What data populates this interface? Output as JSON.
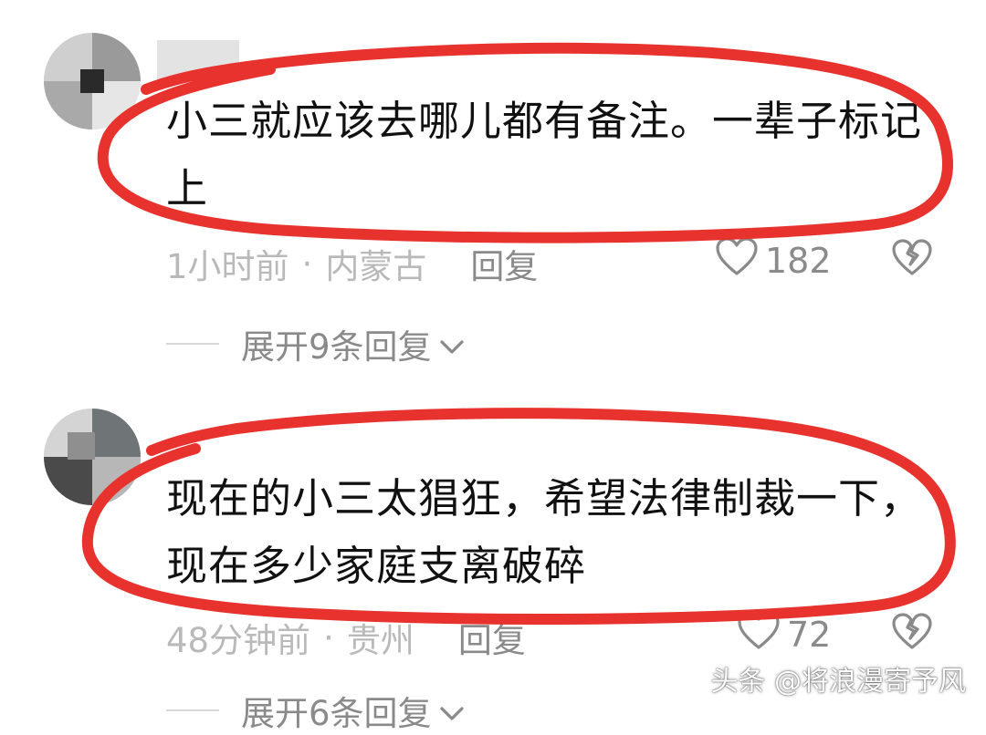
{
  "comments": [
    {
      "text_lines": [
        "小三就应该去哪儿都有备注。一辈子标记",
        "上"
      ],
      "time": "1小时前",
      "separator": "·",
      "location": "内蒙古",
      "reply_label": "回复",
      "like_count": "182",
      "expand_label": "展开9条回复"
    },
    {
      "text_lines": [
        "现在的小三太猖狂，希望法律制裁一下，",
        "现在多少家庭支离破碎"
      ],
      "time": "48分钟前",
      "separator": "·",
      "location": "贵州",
      "reply_label": "回复",
      "like_count": "72",
      "expand_label": "展开6条回复"
    }
  ],
  "watermark": "头条 @将浪漫寄予风",
  "colors": {
    "highlight_ring": "#e8322e",
    "muted_text": "#b9b9b9",
    "action_text": "#8a8a8a"
  },
  "icons": [
    "heart-outline-icon",
    "broken-heart-icon",
    "chevron-down-icon"
  ]
}
